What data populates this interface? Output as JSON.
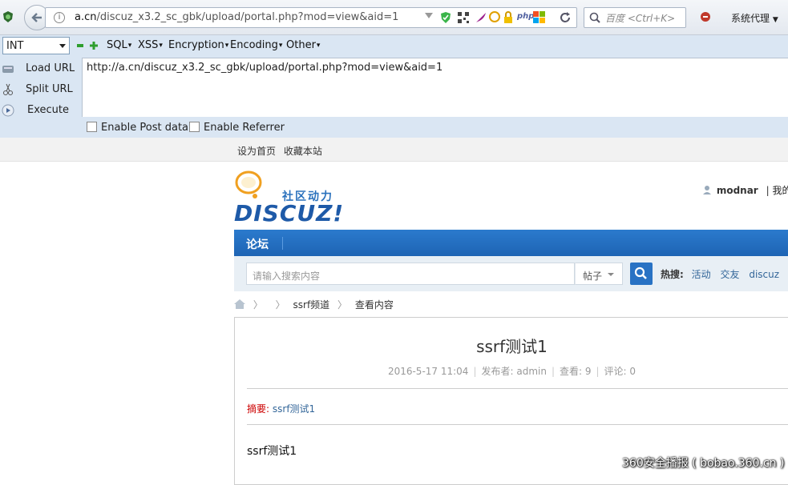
{
  "browser": {
    "url_host": "a.cn",
    "url_path": "/discuz_x3.2_sc_gbk/upload/portal.php?mod=view&aid=1",
    "search_placeholder": "百度 <Ctrl+K>",
    "proxy_label": "系统代理"
  },
  "hackbar": {
    "select_value": "INT",
    "menu": [
      "SQL",
      "XSS",
      "Encryption",
      "Encoding",
      "Other"
    ],
    "load_url": "Load URL",
    "split_url": "Split URL",
    "execute": "Execute",
    "url_value": "http://a.cn/discuz_x3.2_sc_gbk/upload/portal.php?mod=view&aid=1",
    "enable_post": "Enable Post data",
    "enable_referrer": "Enable Referrer"
  },
  "page": {
    "top_links": [
      "设为首页",
      "收藏本站"
    ],
    "logo_tagline": "社区动力",
    "logo_text": "DISCUZ!",
    "username": "modnar",
    "user_more": "我的",
    "nav_tab": "论坛",
    "search_placeholder": "请输入搜索内容",
    "search_type": "帖子",
    "hot_label": "热搜:",
    "hot_keywords": [
      "活动",
      "交友",
      "discuz"
    ],
    "breadcrumb": [
      "ssrf频道",
      "查看内容"
    ],
    "article_title": "ssrf测试1",
    "meta": {
      "date": "2016-5-17 11:04",
      "author": "发布者: admin",
      "views": "查看: 9",
      "comments": "评论: 0"
    },
    "summary_label": "摘要:",
    "summary_value": "ssrf测试1",
    "body": "ssrf测试1",
    "watermark": "360安全播报 ( bobao.360.cn )"
  }
}
